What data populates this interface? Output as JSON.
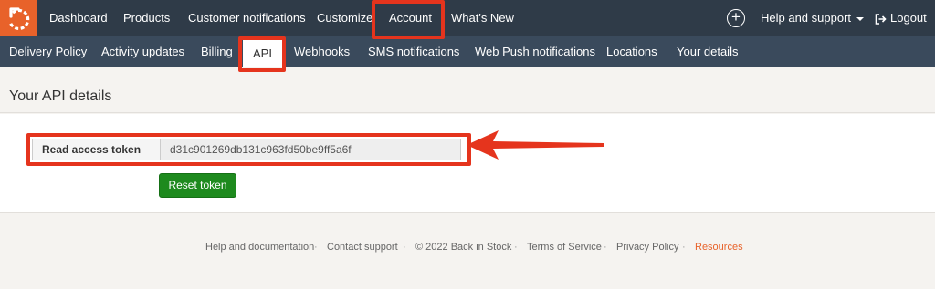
{
  "topnav": {
    "items": [
      "Dashboard",
      "Products",
      "Customer notifications",
      "Customize",
      "Account",
      "What's New"
    ],
    "help_label": "Help and support",
    "logout_label": "Logout",
    "plus_symbol": "+"
  },
  "subnav": {
    "items": [
      "Delivery Policy",
      "Activity updates",
      "Billing",
      "API",
      "Webhooks",
      "SMS notifications",
      "Web Push notifications",
      "Locations",
      "Your details"
    ]
  },
  "page": {
    "title": "Your API details",
    "token_label": "Read access token",
    "token_value": "d31c901269db131c963fd50be9ff5a6f",
    "reset_label": "Reset token"
  },
  "footer": {
    "links": [
      "Help and documentation",
      "Contact support",
      "© 2022 Back in Stock",
      "Terms of Service",
      "Privacy Policy",
      "Resources"
    ],
    "separator": "·"
  },
  "colors": {
    "brand": "#e8622a",
    "navbar": "#2f3b48",
    "subnav": "#3a4a5c",
    "highlight": "#e5341d",
    "button": "#1e8a1e"
  },
  "icons": {
    "logo": "back-in-stock-logo-icon",
    "plus": "plus-circle-icon",
    "caret": "caret-down-icon",
    "logout": "logout-icon",
    "arrow": "red-arrow-annotation"
  }
}
